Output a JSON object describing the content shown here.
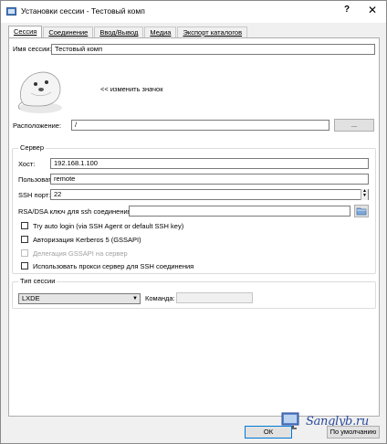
{
  "window": {
    "title": "Установки сессии - Тестовый комп",
    "help_label": "?",
    "close_label": "✕"
  },
  "tabs": [
    {
      "label": "Сессия",
      "active": true
    },
    {
      "label": "Соединение",
      "active": false
    },
    {
      "label": "Ввод/Вывод",
      "active": false
    },
    {
      "label": "Медиа",
      "active": false
    },
    {
      "label": "Экспорт каталогов",
      "active": false
    }
  ],
  "session": {
    "name_label": "Имя сессии:",
    "name_value": "Тестовый комп",
    "change_icon_label": "<< изменить значок",
    "location_label": "Расположение:",
    "location_value": "/",
    "browse_label": "..."
  },
  "server": {
    "group_title": "Сервер",
    "host_label": "Хост:",
    "host_value": "192.168.1.100",
    "user_label": "Пользователь:",
    "user_value": "remote",
    "ssh_port_label": "SSH порт:",
    "ssh_port_value": "22",
    "rsa_label": "RSA/DSA ключ для ssh соединения:",
    "rsa_value": "",
    "try_auto_login_label": "Try auto login (via SSH Agent or default SSH key)",
    "kerberos_label": "Авторизация Kerberos 5 (GSSAPI)",
    "gssapi_delegation_label": "Делегация GSSAPI на сервер",
    "proxy_label": "Использовать прокси сервер для SSH соединения"
  },
  "session_type": {
    "group_title": "Тип сессии",
    "selected": "LXDE",
    "command_label": "Команда:",
    "command_value": ""
  },
  "footer": {
    "ok_label": "ОК",
    "defaults_label": "По умолчанию"
  },
  "watermark": {
    "text": "Sanglyb.ru"
  },
  "icons": {
    "app": "x2go-app-icon",
    "session": "seal-session-icon",
    "folder": "folder-open-icon"
  },
  "colors": {
    "accent": "#0078d7",
    "watermark": "#2b4a9e"
  }
}
